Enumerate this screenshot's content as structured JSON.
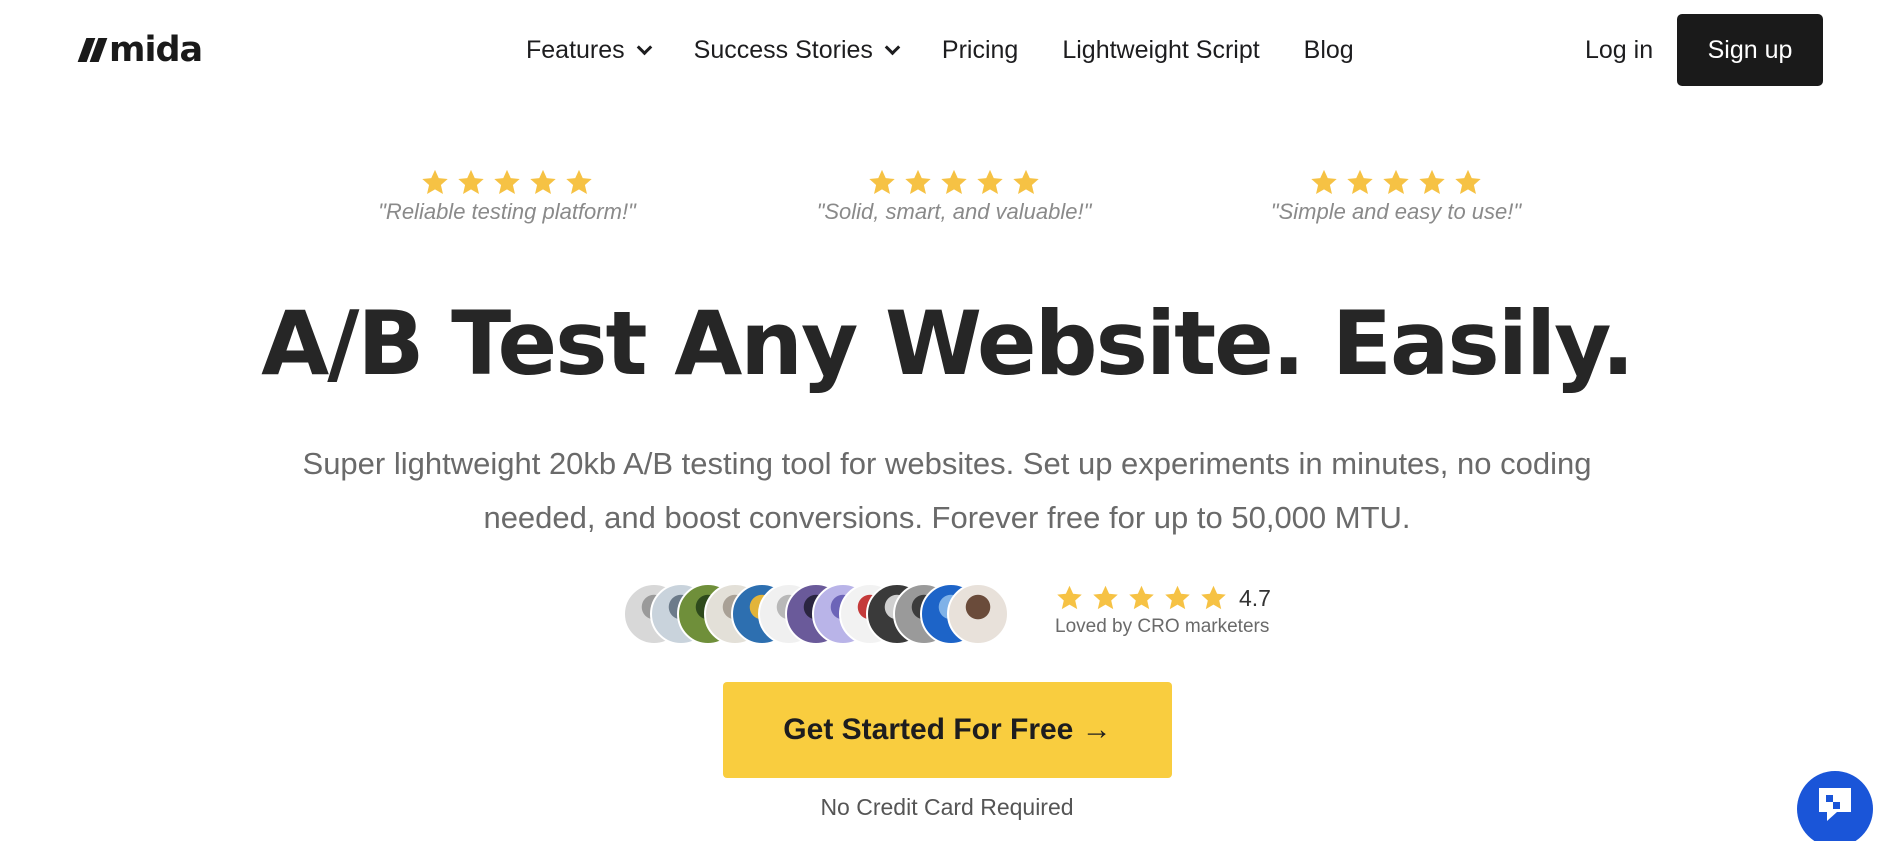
{
  "brand": {
    "logo_text": "mida"
  },
  "nav": {
    "items": [
      {
        "label": "Features",
        "has_dropdown": true
      },
      {
        "label": "Success Stories",
        "has_dropdown": true
      },
      {
        "label": "Pricing",
        "has_dropdown": false
      },
      {
        "label": "Lightweight Script",
        "has_dropdown": false
      },
      {
        "label": "Blog",
        "has_dropdown": false
      }
    ],
    "login_label": "Log in",
    "signup_label": "Sign up"
  },
  "reviews": [
    {
      "stars": 5,
      "quote": "\"Reliable testing platform!\""
    },
    {
      "stars": 5,
      "quote": "\"Solid, smart, and valuable!\""
    },
    {
      "stars": 5,
      "quote": "\"Simple and easy to use!\""
    }
  ],
  "hero": {
    "headline": "A/B Test Any Website. Easily.",
    "subtext": "Super lightweight 20kb A/B testing tool for websites. Set up experiments in minutes, no coding needed, and boost conversions. Forever free for up to 50,000 MTU."
  },
  "social_proof": {
    "avatar_count": 13,
    "stars": 5,
    "rating": "4.7",
    "caption": "Loved by CRO marketers"
  },
  "cta": {
    "label": "Get Started For Free →",
    "note": "No Credit Card Required"
  },
  "chat": {
    "icon": "chat-icon"
  },
  "colors": {
    "star": "#f6c244",
    "cta_bg": "#f9cd3f",
    "signup_bg": "#1a1a1a",
    "chat_bg": "#1a55d8"
  }
}
